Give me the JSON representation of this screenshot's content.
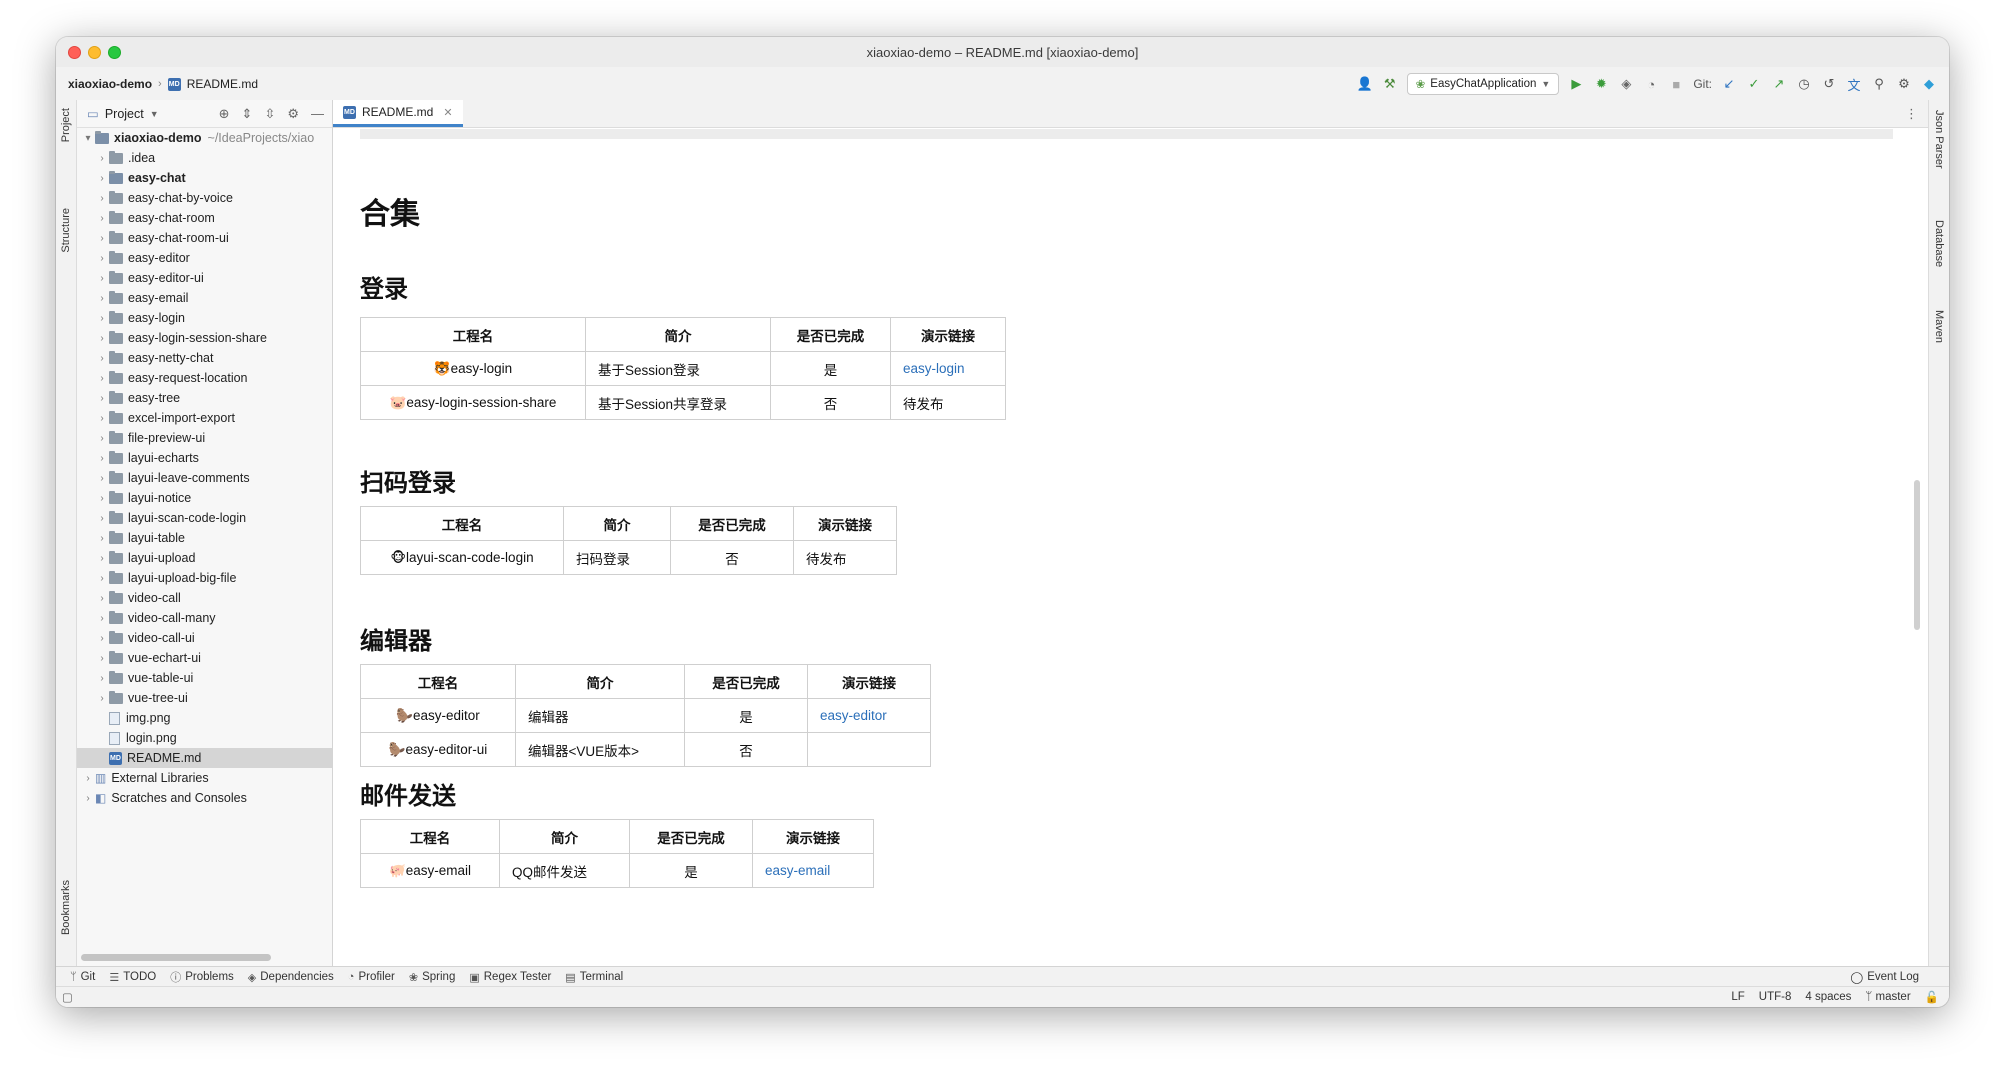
{
  "window": {
    "title": "xiaoxiao-demo – README.md [xiaoxiao-demo]"
  },
  "breadcrumb": {
    "project": "xiaoxiao-demo",
    "file": "README.md",
    "file_icon": "MD"
  },
  "toolbar": {
    "run_config": "EasyChatApplication",
    "git_label": "Git:",
    "icons": [
      "user-icon",
      "hammer-icon",
      "run-icon",
      "debug-icon",
      "coverage-icon",
      "profile-icon",
      "stop-icon",
      "git-update-icon",
      "git-commit-icon",
      "git-push-icon",
      "history-icon",
      "rollback-icon",
      "translate-icon",
      "search-icon",
      "settings-icon",
      "plugin-icon"
    ]
  },
  "left_stripe": {
    "project": "Project",
    "structure": "Structure",
    "bookmarks": "Bookmarks"
  },
  "right_stripe": {
    "json_parser": "Json Parser",
    "database": "Database",
    "maven": "Maven"
  },
  "project_panel": {
    "title": "Project",
    "root": {
      "name": "xiaoxiao-demo",
      "path": "~/IdeaProjects/xiao"
    },
    "items": [
      {
        "name": ".idea",
        "type": "folder",
        "bold": false
      },
      {
        "name": "easy-chat",
        "type": "module",
        "bold": true
      },
      {
        "name": "easy-chat-by-voice",
        "type": "folder",
        "bold": false
      },
      {
        "name": "easy-chat-room",
        "type": "folder",
        "bold": false
      },
      {
        "name": "easy-chat-room-ui",
        "type": "folder",
        "bold": false
      },
      {
        "name": "easy-editor",
        "type": "folder",
        "bold": false
      },
      {
        "name": "easy-editor-ui",
        "type": "folder",
        "bold": false
      },
      {
        "name": "easy-email",
        "type": "folder",
        "bold": false
      },
      {
        "name": "easy-login",
        "type": "folder",
        "bold": false
      },
      {
        "name": "easy-login-session-share",
        "type": "folder",
        "bold": false
      },
      {
        "name": "easy-netty-chat",
        "type": "folder",
        "bold": false
      },
      {
        "name": "easy-request-location",
        "type": "folder",
        "bold": false
      },
      {
        "name": "easy-tree",
        "type": "folder",
        "bold": false
      },
      {
        "name": "excel-import-export",
        "type": "folder",
        "bold": false
      },
      {
        "name": "file-preview-ui",
        "type": "folder",
        "bold": false
      },
      {
        "name": "layui-echarts",
        "type": "folder",
        "bold": false
      },
      {
        "name": "layui-leave-comments",
        "type": "folder",
        "bold": false
      },
      {
        "name": "layui-notice",
        "type": "folder",
        "bold": false
      },
      {
        "name": "layui-scan-code-login",
        "type": "folder",
        "bold": false
      },
      {
        "name": "layui-table",
        "type": "folder",
        "bold": false
      },
      {
        "name": "layui-upload",
        "type": "folder",
        "bold": false
      },
      {
        "name": "layui-upload-big-file",
        "type": "folder",
        "bold": false
      },
      {
        "name": "video-call",
        "type": "folder",
        "bold": false
      },
      {
        "name": "video-call-many",
        "type": "folder",
        "bold": false
      },
      {
        "name": "video-call-ui",
        "type": "folder",
        "bold": false
      },
      {
        "name": "vue-echart-ui",
        "type": "folder",
        "bold": false
      },
      {
        "name": "vue-table-ui",
        "type": "folder",
        "bold": false
      },
      {
        "name": "vue-tree-ui",
        "type": "folder",
        "bold": false
      },
      {
        "name": "img.png",
        "type": "file",
        "bold": false
      },
      {
        "name": "login.png",
        "type": "file",
        "bold": false
      },
      {
        "name": "README.md",
        "type": "md",
        "bold": false,
        "selected": true
      }
    ],
    "external": "External Libraries",
    "scratches": "Scratches and Consoles"
  },
  "editor_tab": {
    "label": "README.md"
  },
  "doc": {
    "h1": "合集",
    "sections": [
      {
        "title": "登录",
        "headers": [
          "工程名",
          "简介",
          "是否已完成",
          "演示链接"
        ],
        "rows": [
          {
            "emoji": "🐯",
            "name": "easy-login",
            "desc": "基于Session登录",
            "done": "是",
            "link": "easy-login"
          },
          {
            "emoji": "🐷",
            "name": "easy-login-session-share",
            "desc": "基于Session共享登录",
            "done": "否",
            "link": "待发布",
            "plain": true
          }
        ]
      },
      {
        "title": "扫码登录",
        "headers": [
          "工程名",
          "简介",
          "是否已完成",
          "演示链接"
        ],
        "rows": [
          {
            "emoji": "🐵",
            "name": "layui-scan-code-login",
            "desc": "扫码登录",
            "done": "否",
            "link": "待发布",
            "plain": true
          }
        ]
      },
      {
        "title": "编辑器",
        "headers": [
          "工程名",
          "简介",
          "是否已完成",
          "演示链接"
        ],
        "rows": [
          {
            "emoji": "🦫",
            "name": "easy-editor",
            "desc": "编辑器",
            "done": "是",
            "link": "easy-editor"
          },
          {
            "emoji": "🦫",
            "name": "easy-editor-ui",
            "desc": "编辑器<VUE版本>",
            "done": "否",
            "link": ""
          }
        ]
      },
      {
        "title": "邮件发送",
        "headers": [
          "工程名",
          "简介",
          "是否已完成",
          "演示链接"
        ],
        "rows": [
          {
            "emoji": "🐖",
            "name": "easy-email",
            "desc": "QQ邮件发送",
            "done": "是",
            "link": "easy-email"
          }
        ]
      }
    ]
  },
  "tool_windows": [
    "Git",
    "TODO",
    "Problems",
    "Dependencies",
    "Profiler",
    "Spring",
    "Regex Tester",
    "Terminal"
  ],
  "event_log": "Event Log",
  "status": {
    "line_sep": "LF",
    "encoding": "UTF-8",
    "indent": "4 spaces",
    "branch": "master"
  }
}
